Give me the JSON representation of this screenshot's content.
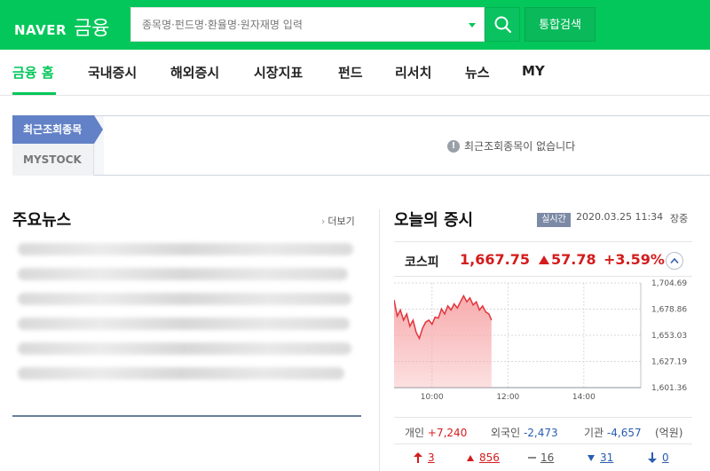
{
  "header": {
    "logo_naver": "NAVER",
    "logo_finance": "금융",
    "search_placeholder": "종목명·펀드명·환율명·원자재명 입력",
    "total_search_label": "통합검색",
    "brand_color": "#03c75a"
  },
  "nav": {
    "items": [
      {
        "label": "금융 홈",
        "active": true
      },
      {
        "label": "국내증시"
      },
      {
        "label": "해외증시"
      },
      {
        "label": "시장지표"
      },
      {
        "label": "펀드"
      },
      {
        "label": "리서치"
      },
      {
        "label": "뉴스"
      },
      {
        "label": "MY"
      }
    ]
  },
  "recent": {
    "tab_recent": "최근조회종목",
    "tab_mystock": "MYSTOCK",
    "empty_message": "최근조회종목이 없습니다"
  },
  "news": {
    "title": "주요뉴스",
    "more_label": "더보기"
  },
  "market": {
    "title": "오늘의 증시",
    "realtime_badge": "실시간",
    "timestamp": "2020.03.25 11:34",
    "status": "장중",
    "index": {
      "name": "코스피",
      "value": "1,667.75",
      "change": "57.78",
      "rate": "+3.59%"
    },
    "investors": {
      "individual_label": "개인",
      "individual_value": "+7,240",
      "foreign_label": "외국인",
      "foreign_value": "-2,473",
      "institution_label": "기관",
      "institution_value": "-4,657",
      "unit": "(억원)"
    },
    "breadth": {
      "upper_limit": "3",
      "rising": "856",
      "unchanged": "16",
      "falling": "31",
      "lower_limit": "0"
    }
  },
  "chart_data": {
    "type": "area",
    "title": "",
    "xlabel": "",
    "ylabel": "",
    "x_ticks": [
      "10:00",
      "12:00",
      "14:00"
    ],
    "y_ticks": [
      "1,704.69",
      "1,678.86",
      "1,653.03",
      "1,627.19",
      "1,601.36"
    ],
    "ylim": [
      1601.36,
      1704.69
    ],
    "session": {
      "start": "09:00",
      "end": "15:30"
    },
    "series": [
      {
        "x": [
          "09:00",
          "09:05",
          "09:10",
          "09:15",
          "09:20",
          "09:25",
          "09:30",
          "09:35",
          "09:40",
          "09:45",
          "09:50",
          "09:55",
          "10:00",
          "10:05",
          "10:10",
          "10:15",
          "10:20",
          "10:25",
          "10:30",
          "10:35",
          "10:40",
          "10:45",
          "10:50",
          "10:55",
          "11:00",
          "11:05",
          "11:10",
          "11:15",
          "11:20",
          "11:25",
          "11:30",
          "11:34"
        ],
        "values": [
          1688,
          1672,
          1678,
          1668,
          1674,
          1662,
          1668,
          1656,
          1650,
          1660,
          1666,
          1668,
          1664,
          1671,
          1670,
          1679,
          1674,
          1682,
          1678,
          1684,
          1680,
          1686,
          1692,
          1686,
          1690,
          1683,
          1686,
          1678,
          1682,
          1676,
          1674,
          1668
        ]
      }
    ],
    "colors": {
      "line": "#e2343a",
      "fill": "#f7a7a9"
    },
    "grid": true
  }
}
